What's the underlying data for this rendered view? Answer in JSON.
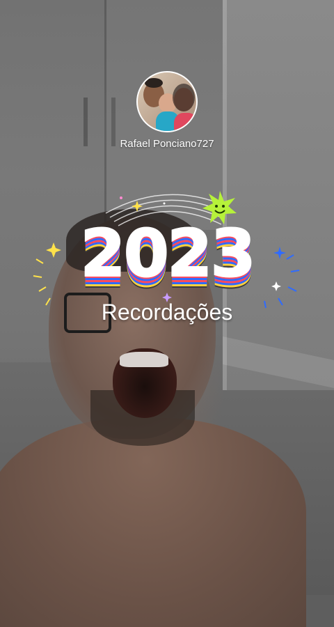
{
  "story": {
    "username": "Rafael Ponciano727",
    "sticker": {
      "year": "2023",
      "subtitle": "Recordações"
    }
  },
  "icons": [
    "smiley-star-icon",
    "sparkle-icon",
    "rainbow-arc-icon"
  ],
  "colors": {
    "year_stripe_red": "#ff4b5c",
    "year_stripe_blue": "#2f6bff",
    "year_stripe_yellow": "#ffd23c",
    "smiley_green": "#b6f23a"
  }
}
